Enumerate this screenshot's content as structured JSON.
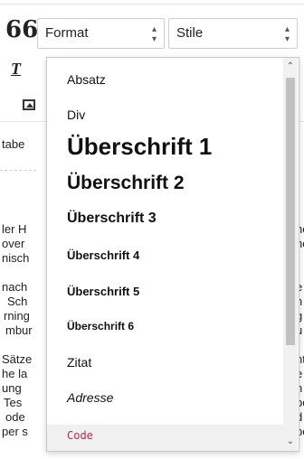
{
  "toolbar": {
    "format_label": "Format",
    "format_arrows": "◆",
    "stile_label": "Stile",
    "stile_arrows": "◆",
    "quote_glyph": "66",
    "t_glyph": "T"
  },
  "background_text": [
    "tabe",
    "ler H",
    "over",
    "nisch",
    "nach",
    "Sch",
    "rning",
    "mbur",
    "Sätze",
    "he la",
    "ung",
    "Tes",
    "ode",
    "per s",
    "nc",
    "nc",
    "t",
    "e",
    "n",
    "g",
    "u",
    "nt",
    "e",
    "n",
    "po",
    "d",
    "pe"
  ],
  "dropdown": {
    "items": [
      {
        "label": "Absatz",
        "style": "paragraph"
      },
      {
        "label": "Div",
        "style": "div"
      },
      {
        "label": "Überschrift 1",
        "style": "h1"
      },
      {
        "label": "Überschrift 2",
        "style": "h2"
      },
      {
        "label": "Überschrift 3",
        "style": "h3"
      },
      {
        "label": "Überschrift 4",
        "style": "h4"
      },
      {
        "label": "Überschrift 5",
        "style": "h5"
      },
      {
        "label": "Überschrift 6",
        "style": "h6"
      },
      {
        "label": "Zitat",
        "style": "blockquote"
      },
      {
        "label": "Adresse",
        "style": "address"
      },
      {
        "label": "Code",
        "style": "code"
      }
    ],
    "code_color": "#c7254e"
  },
  "scrollbar": {
    "up_icon": "⌃",
    "down_icon": "⌄"
  }
}
